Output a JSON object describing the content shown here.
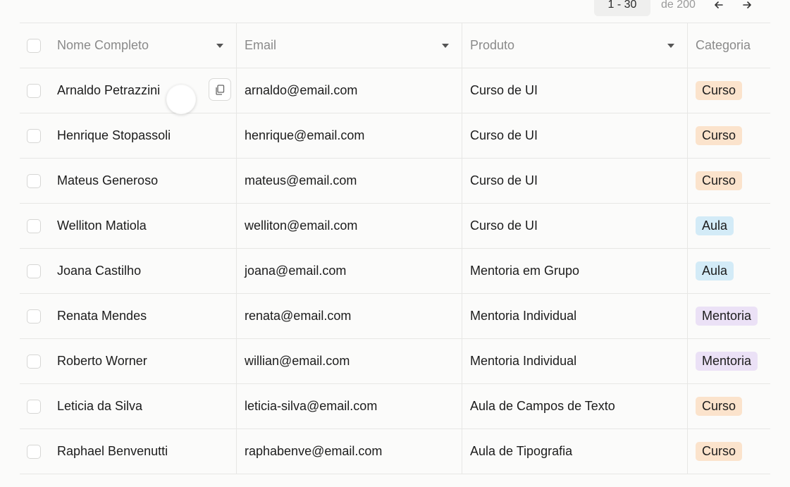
{
  "pagination": {
    "range": "1 - 30",
    "total": "de 200",
    "prev_icon": "arrow-left-icon",
    "next_icon": "arrow-right-icon"
  },
  "columns": {
    "name": "Nome Completo",
    "email": "Email",
    "product": "Produto",
    "category": "Categoria"
  },
  "rows": [
    {
      "name": "Arnaldo Petrazzini",
      "email": "arnaldo@email.com",
      "product": "Curso de UI",
      "category": "Curso"
    },
    {
      "name": "Henrique Stopassoli",
      "email": "henrique@email.com",
      "product": "Curso de UI",
      "category": "Curso"
    },
    {
      "name": "Mateus Generoso",
      "email": "mateus@email.com",
      "product": "Curso de UI",
      "category": "Curso"
    },
    {
      "name": "Welliton Matiola",
      "email": "welliton@email.com",
      "product": "Curso de UI",
      "category": "Aula"
    },
    {
      "name": "Joana Castilho",
      "email": "joana@email.com",
      "product": "Mentoria em Grupo",
      "category": "Aula"
    },
    {
      "name": "Renata Mendes",
      "email": "renata@email.com",
      "product": "Mentoria Individual",
      "category": "Mentoria"
    },
    {
      "name": "Roberto Worner",
      "email": "willian@email.com",
      "product": "Mentoria Individual",
      "category": "Mentoria"
    },
    {
      "name": "Leticia da Silva",
      "email": "leticia-silva@email.com",
      "product": "Aula de Campos de Texto",
      "category": "Curso"
    },
    {
      "name": "Raphael Benvenutti",
      "email": "raphabenve@email.com",
      "product": "Aula de Tipografia",
      "category": "Curso"
    }
  ],
  "category_colors": {
    "Curso": {
      "bg": "#fbe3cc",
      "fg": "#1c1c1c"
    },
    "Aula": {
      "bg": "#d3ebf7",
      "fg": "#1c1c1c"
    },
    "Mentoria": {
      "bg": "#ebe1f6",
      "fg": "#1c1c1c"
    }
  },
  "copy_icon": "copy-icon"
}
